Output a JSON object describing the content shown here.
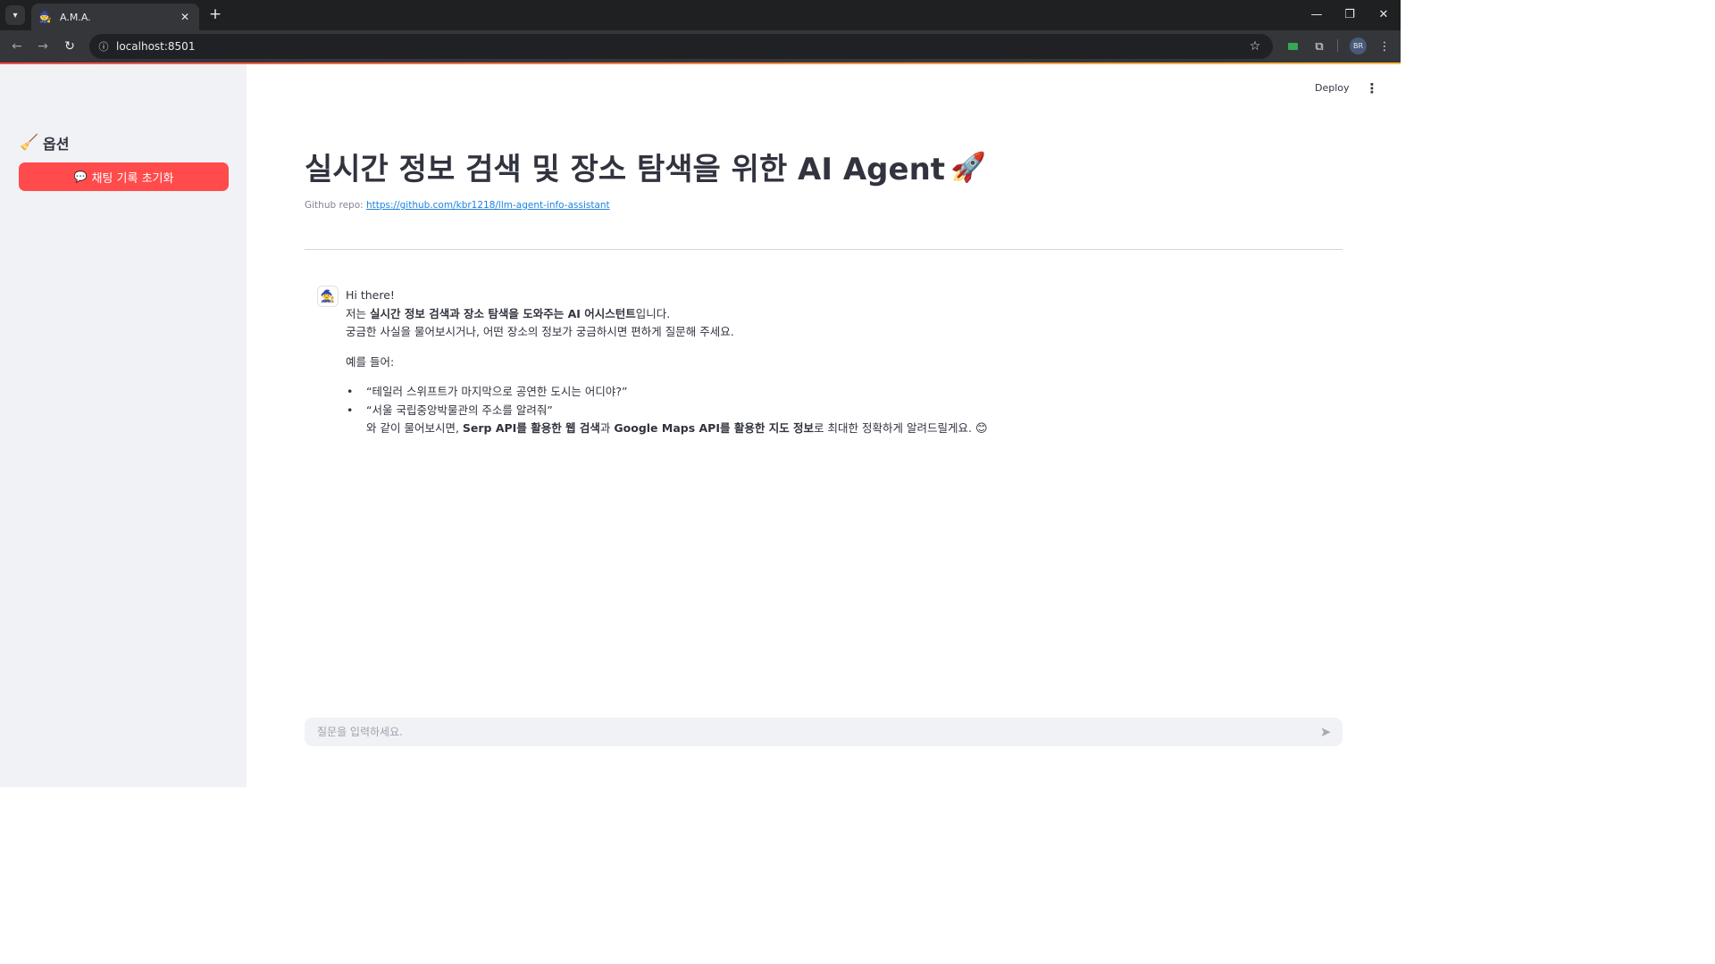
{
  "browser": {
    "tab_title": "A.M.A.",
    "tab_favicon": "🧙",
    "url": "localhost:8501",
    "profile_initials": "BR"
  },
  "sidebar": {
    "title": "옵션",
    "title_icon": "🧹",
    "reset_button_icon": "💬",
    "reset_button_label": "채팅 기록 초기화"
  },
  "header": {
    "deploy_label": "Deploy"
  },
  "main": {
    "title": "실시간 정보 검색 및 장소 탐색을 위한 AI Agent",
    "title_icon": "🚀",
    "repo_prefix": "Github repo:",
    "repo_url": "https://github.com/kbr1218/llm-agent-info-assistant"
  },
  "message": {
    "avatar": "🧙",
    "greeting": "Hi there!",
    "intro_prefix": "저는 ",
    "intro_bold": "실시간 정보 검색과 장소 탐색을 도와주는 AI 어시스턴트",
    "intro_suffix": "입니다.",
    "line2": "궁금한 사실을 물어보시거나, 어떤 장소의 정보가 궁금하시면 편하게 질문해 주세요.",
    "example_header": "예를 들어:",
    "example1": "“테일러 스위프트가 마지막으로 공연한 도시는 어디야?”",
    "example2": "“서울 국립중앙박물관의 주소를 알려줘”",
    "closing_prefix": "와 같이 물어보시면, ",
    "closing_bold1": "Serp API를 활용한 웹 검색",
    "closing_mid": "과 ",
    "closing_bold2": "Google Maps API를 활용한 지도 정보",
    "closing_suffix": "로 최대한 정확하게 알려드릴게요.",
    "closing_emoji": "😊"
  },
  "chat_input": {
    "placeholder": "질문을 입력하세요."
  },
  "colors": {
    "accent": "#ff4b4b",
    "sidebar_bg": "#f0f2f6",
    "link": "#1c83e1",
    "text": "#31333f"
  }
}
